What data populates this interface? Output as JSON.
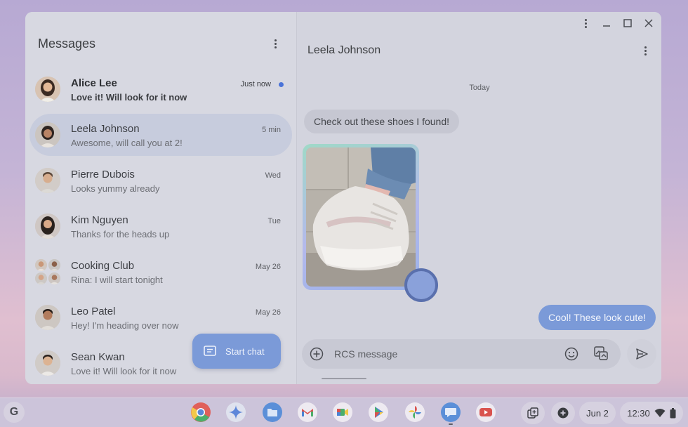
{
  "sidebar": {
    "title": "Messages",
    "start_chat_label": "Start chat",
    "conversations": [
      {
        "name": "Alice Lee",
        "preview": "Love it! Will look for it now",
        "time": "Just now",
        "unread": true
      },
      {
        "name": "Leela Johnson",
        "preview": "Awesome, will call you at 2!",
        "time": "5 min",
        "selected": true
      },
      {
        "name": "Pierre Dubois",
        "preview": "Looks yummy already",
        "time": "Wed"
      },
      {
        "name": "Kim Nguyen",
        "preview": "Thanks for the heads up",
        "time": "Tue"
      },
      {
        "name": "Cooking Club",
        "preview": "Rina: I will start tonight",
        "time": "May 26"
      },
      {
        "name": "Leo Patel",
        "preview": "Hey! I'm heading over now",
        "time": "May 26"
      },
      {
        "name": "Sean Kwan",
        "preview": "Love it! Will look for it now",
        "time": ""
      }
    ]
  },
  "chat": {
    "title": "Leela Johnson",
    "day_separator": "Today",
    "incoming_message": "Check out these shoes I found!",
    "outgoing_message": "Cool! These look cute!",
    "compose_placeholder": "RCS message"
  },
  "shelf": {
    "launcher_label": "G",
    "date": "Jun 2",
    "time": "12:30",
    "apps": [
      "chrome-icon",
      "gemini-icon",
      "files-icon",
      "gmail-icon",
      "meet-icon",
      "play-store-icon",
      "photos-icon",
      "messages-icon",
      "youtube-icon"
    ]
  },
  "colors": {
    "accent": "#7b9ad8",
    "unread_dot": "#4a73d8",
    "window_bg": "#d3d4de"
  }
}
